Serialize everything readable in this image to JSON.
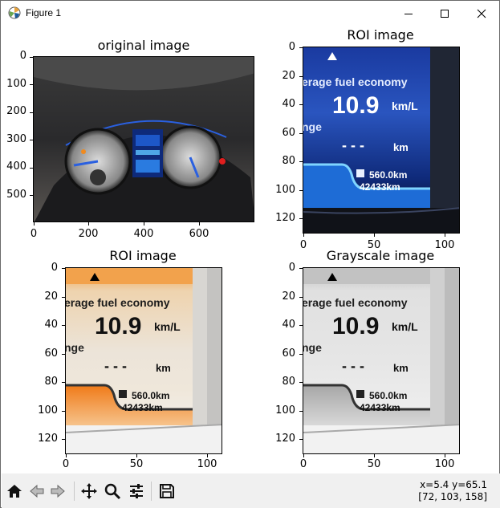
{
  "window": {
    "title": "Figure 1"
  },
  "plots": {
    "p1": {
      "title": "original image",
      "yticks": [
        "0",
        "100",
        "200",
        "300",
        "400",
        "500"
      ],
      "xticks": [
        "0",
        "200",
        "400",
        "600"
      ]
    },
    "p2": {
      "title": "ROI image",
      "yticks": [
        "0",
        "20",
        "40",
        "60",
        "80",
        "100",
        "120"
      ],
      "xticks": [
        "0",
        "50",
        "100"
      ]
    },
    "p3": {
      "title": "ROI image",
      "yticks": [
        "0",
        "20",
        "40",
        "60",
        "80",
        "100",
        "120"
      ],
      "xticks": [
        "0",
        "50",
        "100"
      ]
    },
    "p4": {
      "title": "Grayscale image",
      "yticks": [
        "0",
        "20",
        "40",
        "60",
        "80",
        "100",
        "120"
      ],
      "xticks": [
        "0",
        "50",
        "100"
      ]
    }
  },
  "dash": {
    "fuel_label": "erage fuel economy",
    "fuel_value": "10.9",
    "fuel_unit": "km/L",
    "range_label": "nge",
    "range_dashes": "- - -",
    "range_unit": "km",
    "trip": "560.0km",
    "odo": "42433km"
  },
  "toolbar": {
    "coords_line1": "x=5.4 y=65.1",
    "coords_line2": "[72, 103, 158]"
  }
}
